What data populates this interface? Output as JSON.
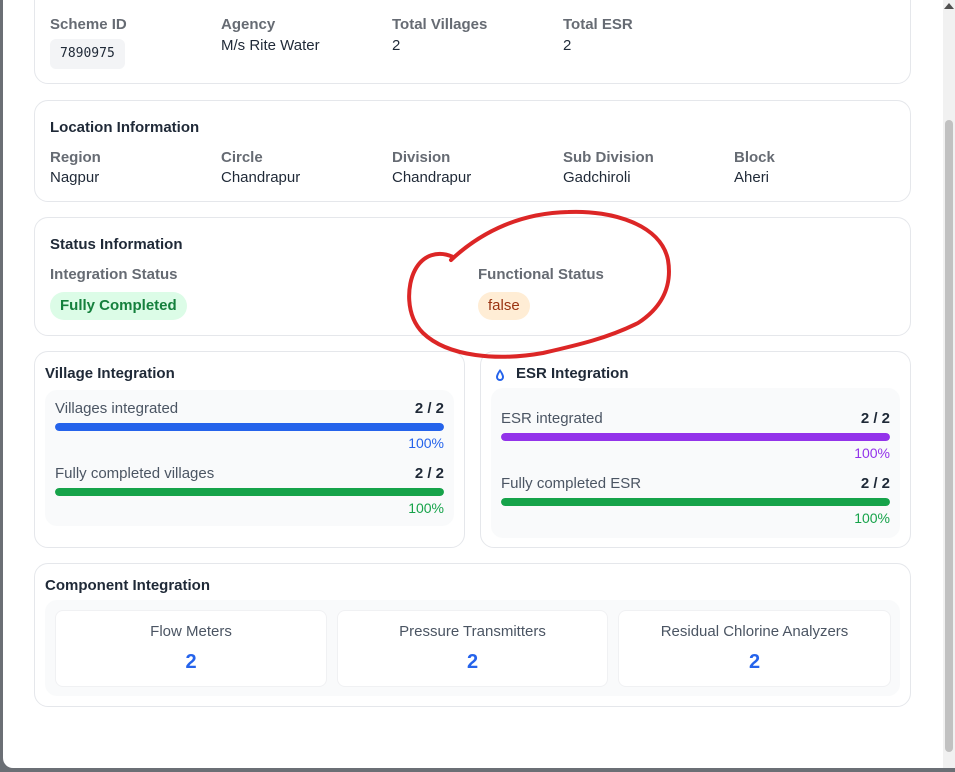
{
  "scheme": {
    "scheme_id_label": "Scheme ID",
    "scheme_id": "7890975",
    "agency_label": "Agency",
    "agency": "M/s Rite Water",
    "total_villages_label": "Total Villages",
    "total_villages": "2",
    "total_esr_label": "Total ESR",
    "total_esr": "2"
  },
  "location": {
    "title": "Location Information",
    "fields": [
      {
        "label": "Region",
        "value": "Nagpur"
      },
      {
        "label": "Circle",
        "value": "Chandrapur"
      },
      {
        "label": "Division",
        "value": "Chandrapur"
      },
      {
        "label": "Sub Division",
        "value": "Gadchiroli"
      },
      {
        "label": "Block",
        "value": "Aheri"
      }
    ]
  },
  "status": {
    "title": "Status Information",
    "integration_label": "Integration Status",
    "integration_value": "Fully Completed",
    "functional_label": "Functional Status",
    "functional_value": "false"
  },
  "village_integration": {
    "title": "Village Integration",
    "rows": [
      {
        "label": "Villages integrated",
        "count": "2 / 2",
        "percent_text": "100%",
        "fraction": 1.0,
        "color": "#2563eb"
      },
      {
        "label": "Fully completed villages",
        "count": "2 / 2",
        "percent_text": "100%",
        "fraction": 1.0,
        "color": "#16a34a"
      }
    ]
  },
  "esr_integration": {
    "title": "ESR Integration",
    "icon": "droplet-icon",
    "rows": [
      {
        "label": "ESR integrated",
        "count": "2 / 2",
        "percent_text": "100%",
        "fraction": 1.0,
        "color": "#9333ea"
      },
      {
        "label": "Fully completed ESR",
        "count": "2 / 2",
        "percent_text": "100%",
        "fraction": 1.0,
        "color": "#16a34a"
      }
    ]
  },
  "components": {
    "title": "Component Integration",
    "items": [
      {
        "label": "Flow Meters",
        "value": "2"
      },
      {
        "label": "Pressure Transmitters",
        "value": "2"
      },
      {
        "label": "Residual Chlorine Analyzers",
        "value": "2"
      }
    ]
  },
  "colors": {
    "success_bg": "#dcfce7",
    "success_text": "#15803d",
    "warning_bg": "#ffedd5",
    "warning_text": "#9a3412",
    "annotation": "#dc2626"
  }
}
